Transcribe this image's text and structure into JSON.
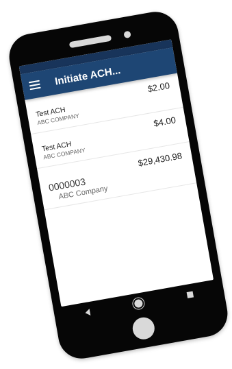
{
  "app_bar": {
    "title": "Initiate ACH..."
  },
  "transactions": [
    {
      "name": "Test ACH",
      "company": "ABC COMPANY",
      "amount": "$2.00"
    },
    {
      "name": "Test ACH",
      "company": "ABC COMPANY",
      "amount": "$4.00"
    },
    {
      "name": "0000003",
      "company": "ABC Company",
      "amount": "$29,430.98"
    }
  ],
  "icons": {
    "menu": "hamburger-menu-icon",
    "nav_back": "triangle-back-icon",
    "nav_home": "circle-home-icon",
    "nav_recent": "square-recent-apps-icon"
  },
  "colors": {
    "app_bar": "#1e4674",
    "status_strip": "#18345a",
    "phone_body": "#060606",
    "phone_controls": "#d9d9d9"
  }
}
